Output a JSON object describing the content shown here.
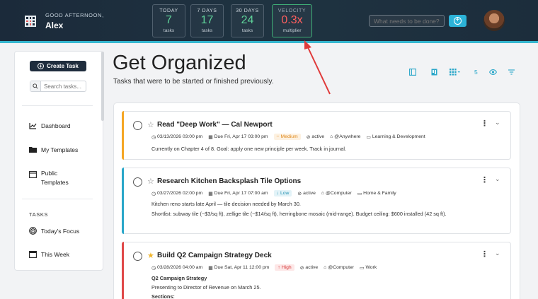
{
  "header": {
    "greeting": "GOOD AFTERNOON,",
    "user_name": "Alex",
    "stats": [
      {
        "label": "TODAY",
        "value": "7",
        "sub": "tasks"
      },
      {
        "label": "7 DAYS",
        "value": "17",
        "sub": "tasks"
      },
      {
        "label": "30 DAYS",
        "value": "24",
        "sub": "tasks"
      },
      {
        "label": "VELOCITY",
        "value": "0.3x",
        "sub": "multiplier"
      }
    ],
    "search_placeholder": "What needs to be done?"
  },
  "sidebar": {
    "create_label": "Create Task",
    "search_placeholder": "Search tasks...",
    "items": [
      {
        "label": "Dashboard",
        "icon": "chart-line-icon"
      },
      {
        "label": "My Templates",
        "icon": "folder-icon"
      },
      {
        "label": "Public Templates",
        "icon": "window-icon"
      }
    ],
    "section_title": "TASKS",
    "task_items": [
      {
        "label": "Today's Focus",
        "icon": "target-icon"
      },
      {
        "label": "This Week",
        "icon": "calendar-icon"
      }
    ]
  },
  "main": {
    "title": "Get Organized",
    "subtitle": "Tasks that were to be started or finished previously.",
    "view_count": "5"
  },
  "tasks": [
    {
      "title": "Read \"Deep Work\" — Cal Newport",
      "starred": false,
      "start": "03/13/2026 03:00 pm",
      "due": "Due Fri, Apr 17 03:00 pm",
      "priority": "Medium",
      "status": "active",
      "context": "@Anywhere",
      "project": "Learning & Development",
      "desc": [
        "Currently on Chapter 4 of 8. Goal: apply one new principle per week. Track in journal."
      ]
    },
    {
      "title": "Research Kitchen Backsplash Tile Options",
      "starred": false,
      "start": "03/27/2026 02:00 pm",
      "due": "Due Fri, Apr 17 07:00 am",
      "priority": "Low",
      "status": "active",
      "context": "@Computer",
      "project": "Home & Family",
      "desc": [
        "Kitchen reno starts late April — tile decision needed by March 30.",
        "Shortlist: subway tile (~$3/sq ft), zellige tile (~$14/sq ft), herringbone mosaic (mid-range). Budget ceiling: $600 installed (42 sq ft)."
      ]
    },
    {
      "title": "Build Q2 Campaign Strategy Deck",
      "starred": true,
      "start": "03/28/2026 04:00 am",
      "due": "Due Sat, Apr 11 12:00 pm",
      "priority": "High",
      "status": "active",
      "context": "@Computer",
      "project": "Work",
      "desc": [
        "Q2 Campaign Strategy",
        "Presenting to Director of Revenue on March 25.",
        "Sections:"
      ]
    }
  ],
  "colors": {
    "medium": "#f5a623",
    "low": "#2aa7c9",
    "high": "#e04848",
    "accent": "#2cb3d8"
  }
}
